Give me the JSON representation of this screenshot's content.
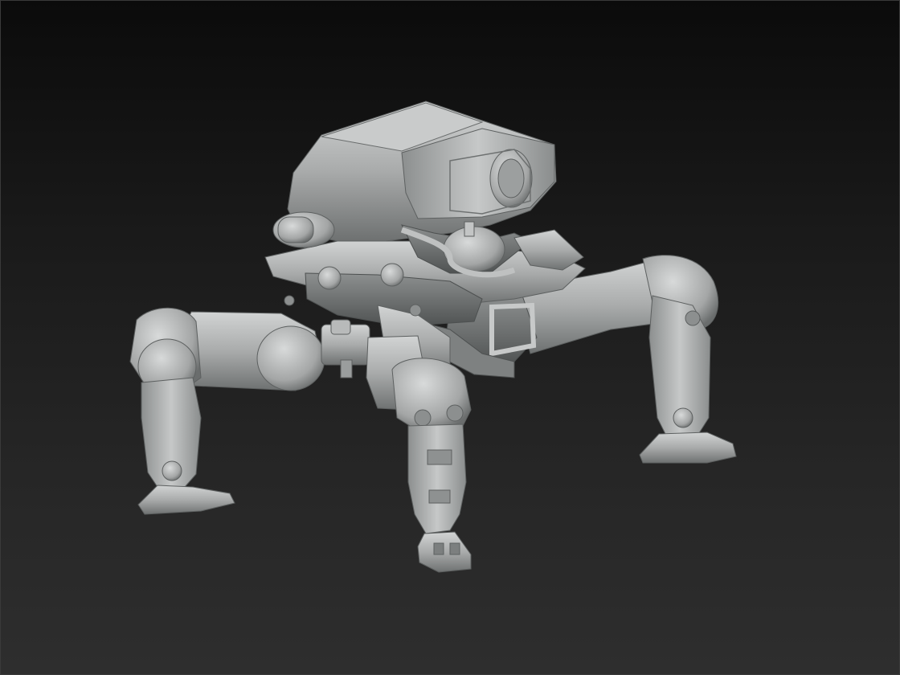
{
  "viewport": {
    "kind": "3d-sculpt-viewport",
    "background_top": "#0b0b0b",
    "background_bottom": "#2e2e2e"
  },
  "model": {
    "subject": "quadruped-mech-robot-sculpt",
    "material_color": "#a9abab",
    "highlight_color": "#d4d6d6",
    "shadow_color": "#5f6262"
  }
}
